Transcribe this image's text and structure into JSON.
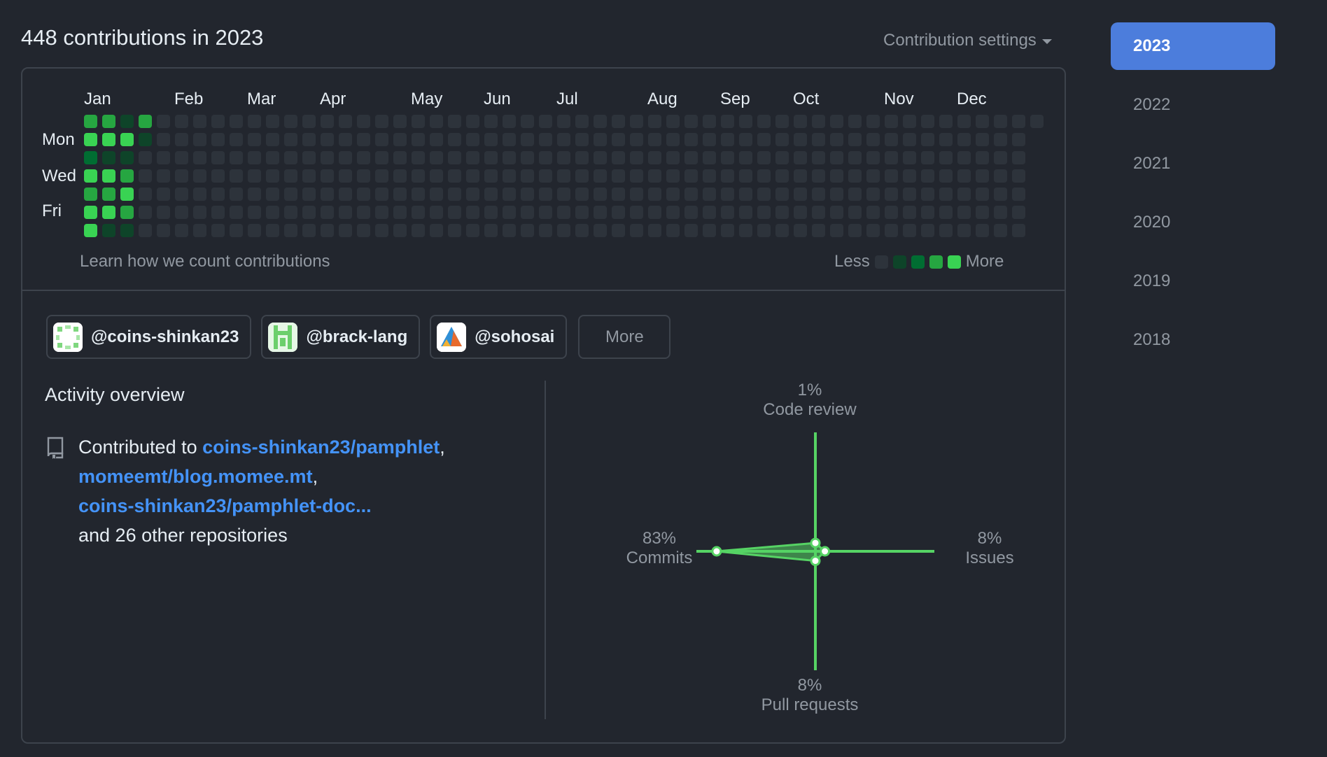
{
  "header": {
    "title": "448 contributions in 2023",
    "settings_label": "Contribution settings"
  },
  "calendar": {
    "months": [
      "Jan",
      "Feb",
      "Mar",
      "Apr",
      "May",
      "Jun",
      "Jul",
      "Aug",
      "Sep",
      "Oct",
      "Nov",
      "Dec"
    ],
    "day_labels": [
      "Mon",
      "Wed",
      "Fri"
    ],
    "learn_link": "Learn how we count contributions",
    "legend_less": "Less",
    "legend_more": "More",
    "level_colors": [
      "#2d333b",
      "#0e4429",
      "#006d32",
      "#26a641",
      "#39d353"
    ],
    "active_weeks": [
      [
        3,
        4,
        2,
        4,
        3,
        4,
        4
      ],
      [
        3,
        4,
        1,
        4,
        3,
        4,
        1
      ],
      [
        1,
        4,
        1,
        3,
        4,
        3,
        1
      ],
      [
        3,
        1,
        0,
        0,
        0,
        0,
        0
      ]
    ]
  },
  "organizations": [
    {
      "handle": "@coins-shinkan23"
    },
    {
      "handle": "@brack-lang"
    },
    {
      "handle": "@sohosai"
    }
  ],
  "more_button": "More",
  "activity": {
    "title": "Activity overview",
    "contributed_prefix": "Contributed to",
    "repos": [
      "coins-shinkan23/pamphlet",
      "momeemt/blog.momee.mt",
      "coins-shinkan23/pamphlet-doc..."
    ],
    "suffix": "and 26 other repositories"
  },
  "radar": {
    "code_review": {
      "percent": "1%",
      "label": "Code review",
      "value": 1
    },
    "issues": {
      "percent": "8%",
      "label": "Issues",
      "value": 8
    },
    "pull_requests": {
      "percent": "8%",
      "label": "Pull requests",
      "value": 8
    },
    "commits": {
      "percent": "83%",
      "label": "Commits",
      "value": 83
    },
    "color": "#56d364"
  },
  "years": [
    "2023",
    "2022",
    "2021",
    "2020",
    "2019",
    "2018"
  ],
  "selected_year": "2023"
}
